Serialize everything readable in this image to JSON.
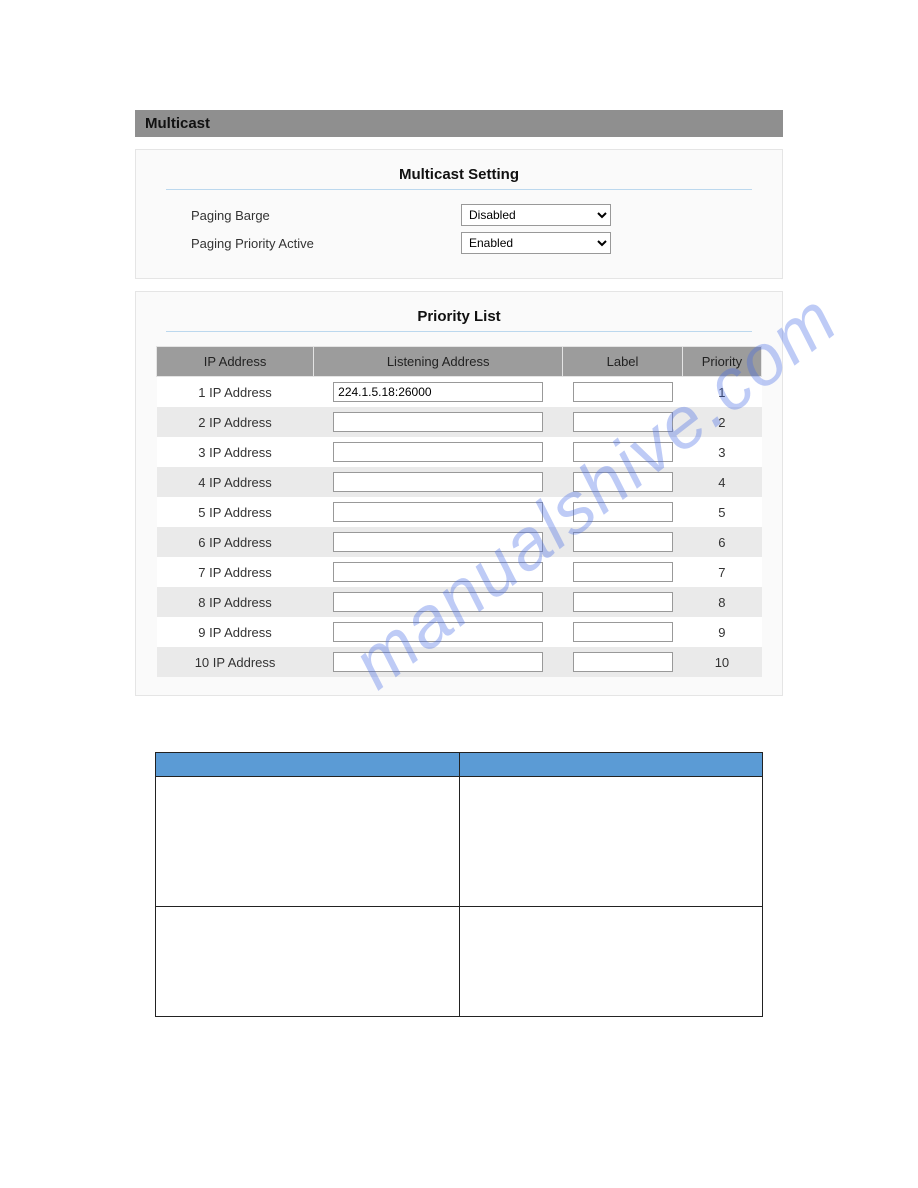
{
  "watermark": "manualshive.com",
  "titlebar": "Multicast",
  "multicast_setting": {
    "title": "Multicast Setting",
    "paging_barge_label": "Paging Barge",
    "paging_barge_value": "Disabled",
    "paging_priority_active_label": "Paging Priority Active",
    "paging_priority_active_value": "Enabled"
  },
  "priority_list": {
    "title": "Priority List",
    "headers": {
      "ip_address": "IP Address",
      "listening_address": "Listening Address",
      "label": "Label",
      "priority": "Priority"
    },
    "rows": [
      {
        "name": "1 IP Address",
        "listening": "224.1.5.18:26000",
        "label": "",
        "priority": "1"
      },
      {
        "name": "2 IP Address",
        "listening": "",
        "label": "",
        "priority": "2"
      },
      {
        "name": "3 IP Address",
        "listening": "",
        "label": "",
        "priority": "3"
      },
      {
        "name": "4 IP Address",
        "listening": "",
        "label": "",
        "priority": "4"
      },
      {
        "name": "5 IP Address",
        "listening": "",
        "label": "",
        "priority": "5"
      },
      {
        "name": "6 IP Address",
        "listening": "",
        "label": "",
        "priority": "6"
      },
      {
        "name": "7 IP Address",
        "listening": "",
        "label": "",
        "priority": "7"
      },
      {
        "name": "8 IP Address",
        "listening": "",
        "label": "",
        "priority": "8"
      },
      {
        "name": "9 IP Address",
        "listening": "",
        "label": "",
        "priority": "9"
      },
      {
        "name": "10 IP Address",
        "listening": "",
        "label": "",
        "priority": "10"
      }
    ]
  }
}
